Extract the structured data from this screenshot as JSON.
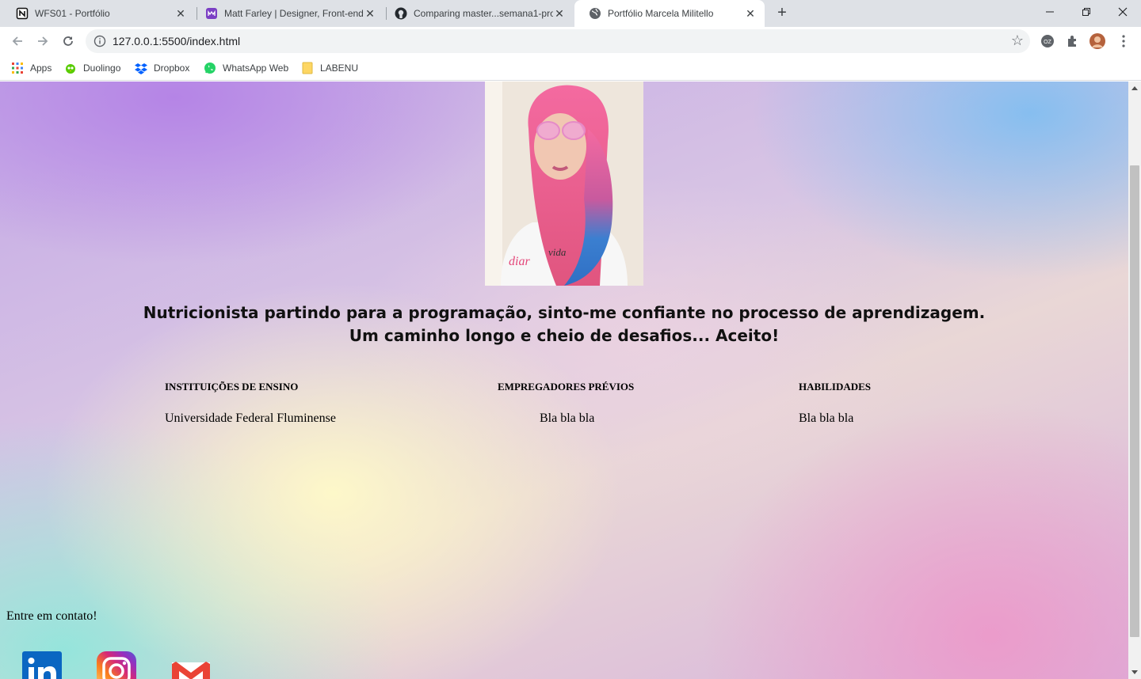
{
  "browser": {
    "tabs": [
      {
        "title": "WFS01 - Portfólio",
        "icon": "notion-icon",
        "active": false
      },
      {
        "title": "Matt Farley | Designer, Front-end",
        "icon": "mf-logo-icon",
        "active": false
      },
      {
        "title": "Comparing master...semana1-pro",
        "icon": "github-icon",
        "active": false
      },
      {
        "title": "Portfólio Marcela Militello",
        "icon": "globe-icon",
        "active": true
      }
    ],
    "new_tab_label": "+",
    "url": "127.0.0.1:5500/index.html",
    "bookmarks": [
      {
        "label": "Apps",
        "icon": "apps-grid-icon"
      },
      {
        "label": "Duolingo",
        "icon": "duolingo-icon"
      },
      {
        "label": "Dropbox",
        "icon": "dropbox-icon"
      },
      {
        "label": "WhatsApp Web",
        "icon": "whatsapp-icon"
      },
      {
        "label": "LABENU",
        "icon": "folder-icon"
      }
    ],
    "colors": {
      "tabstrip": "#dee1e6",
      "omnibox": "#f1f3f4",
      "accent": "#1a73e8"
    }
  },
  "page": {
    "bio_line1": "Nutricionista partindo para a programação, sinto-me confiante no processo de aprendizagem.",
    "bio_line2": "Um caminho longo e cheio de desafios... Aceito!",
    "columns": [
      {
        "title": "INSTITUIÇÕES DE ENSINO",
        "text": "Universidade Federal Fluminense"
      },
      {
        "title": "EMPREGADORES PRÉVIOS",
        "text": "Bla bla bla"
      },
      {
        "title": "HABILIDADES",
        "text": "Bla bla bla"
      }
    ],
    "contact_label": "Entre em contato!",
    "social": [
      "linkedin-icon",
      "instagram-icon",
      "gmail-icon"
    ]
  }
}
